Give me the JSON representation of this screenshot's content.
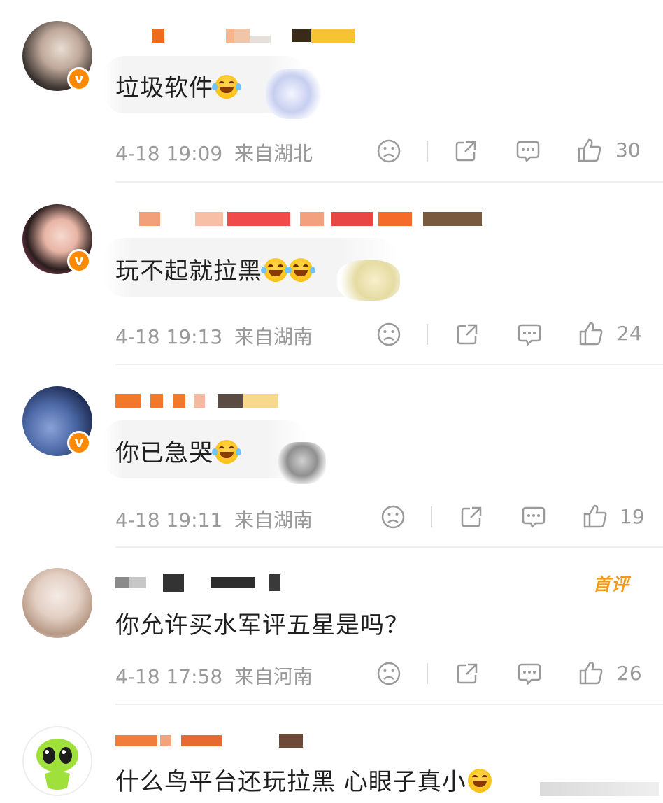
{
  "comments": [
    {
      "text": "垃圾软件",
      "time": "4-18 19:09",
      "location": "来自湖北",
      "likes": "30",
      "verified": true,
      "first_comment": false
    },
    {
      "text": "玩不起就拉黑",
      "time": "4-18 19:13",
      "location": "来自湖南",
      "likes": "24",
      "verified": true,
      "first_comment": false
    },
    {
      "text": "你已急哭",
      "time": "4-18 19:11",
      "location": "来自湖南",
      "likes": "19",
      "verified": true,
      "first_comment": false
    },
    {
      "text": "你允许买水军评五星是吗？",
      "time": "4-18 17:58",
      "location": "来自河南",
      "likes": "26",
      "verified": false,
      "first_comment": true,
      "first_label": "首评"
    },
    {
      "text": "什么鸟平台还玩拉黑 心眼子真小",
      "verified": false,
      "first_comment": false
    }
  ],
  "icons": {
    "dislike": "sad-face-icon",
    "share": "share-icon",
    "reply": "comment-icon",
    "like": "thumbs-up-icon"
  },
  "colors": {
    "accent": "#ff8a00",
    "meta": "#9a9a9a",
    "first_badge": "#f29a1e"
  }
}
